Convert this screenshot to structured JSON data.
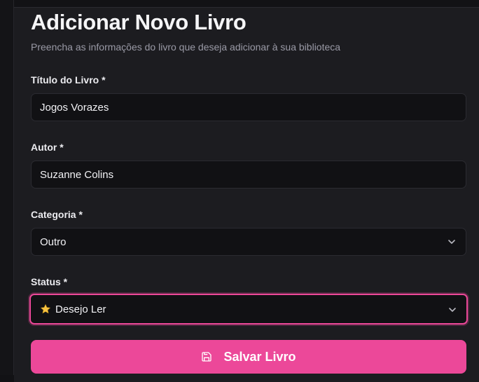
{
  "header": {
    "title": "Adicionar Novo Livro",
    "subtitle": "Preencha as informações do livro que deseja adicionar à sua biblioteca"
  },
  "form": {
    "title_field": {
      "label": "Título do Livro *",
      "value": "Jogos Vorazes"
    },
    "author_field": {
      "label": "Autor *",
      "value": "Suzanne Colins"
    },
    "category_field": {
      "label": "Categoria *",
      "selected": "Outro"
    },
    "status_field": {
      "label": "Status *",
      "selected": "Desejo Ler",
      "icon": "star-icon"
    },
    "save_label": "Salvar Livro",
    "save_icon": "floppy-disk-icon"
  },
  "colors": {
    "accent": "#ec4899",
    "background": "#1c1c20",
    "field_bg": "#111114"
  }
}
